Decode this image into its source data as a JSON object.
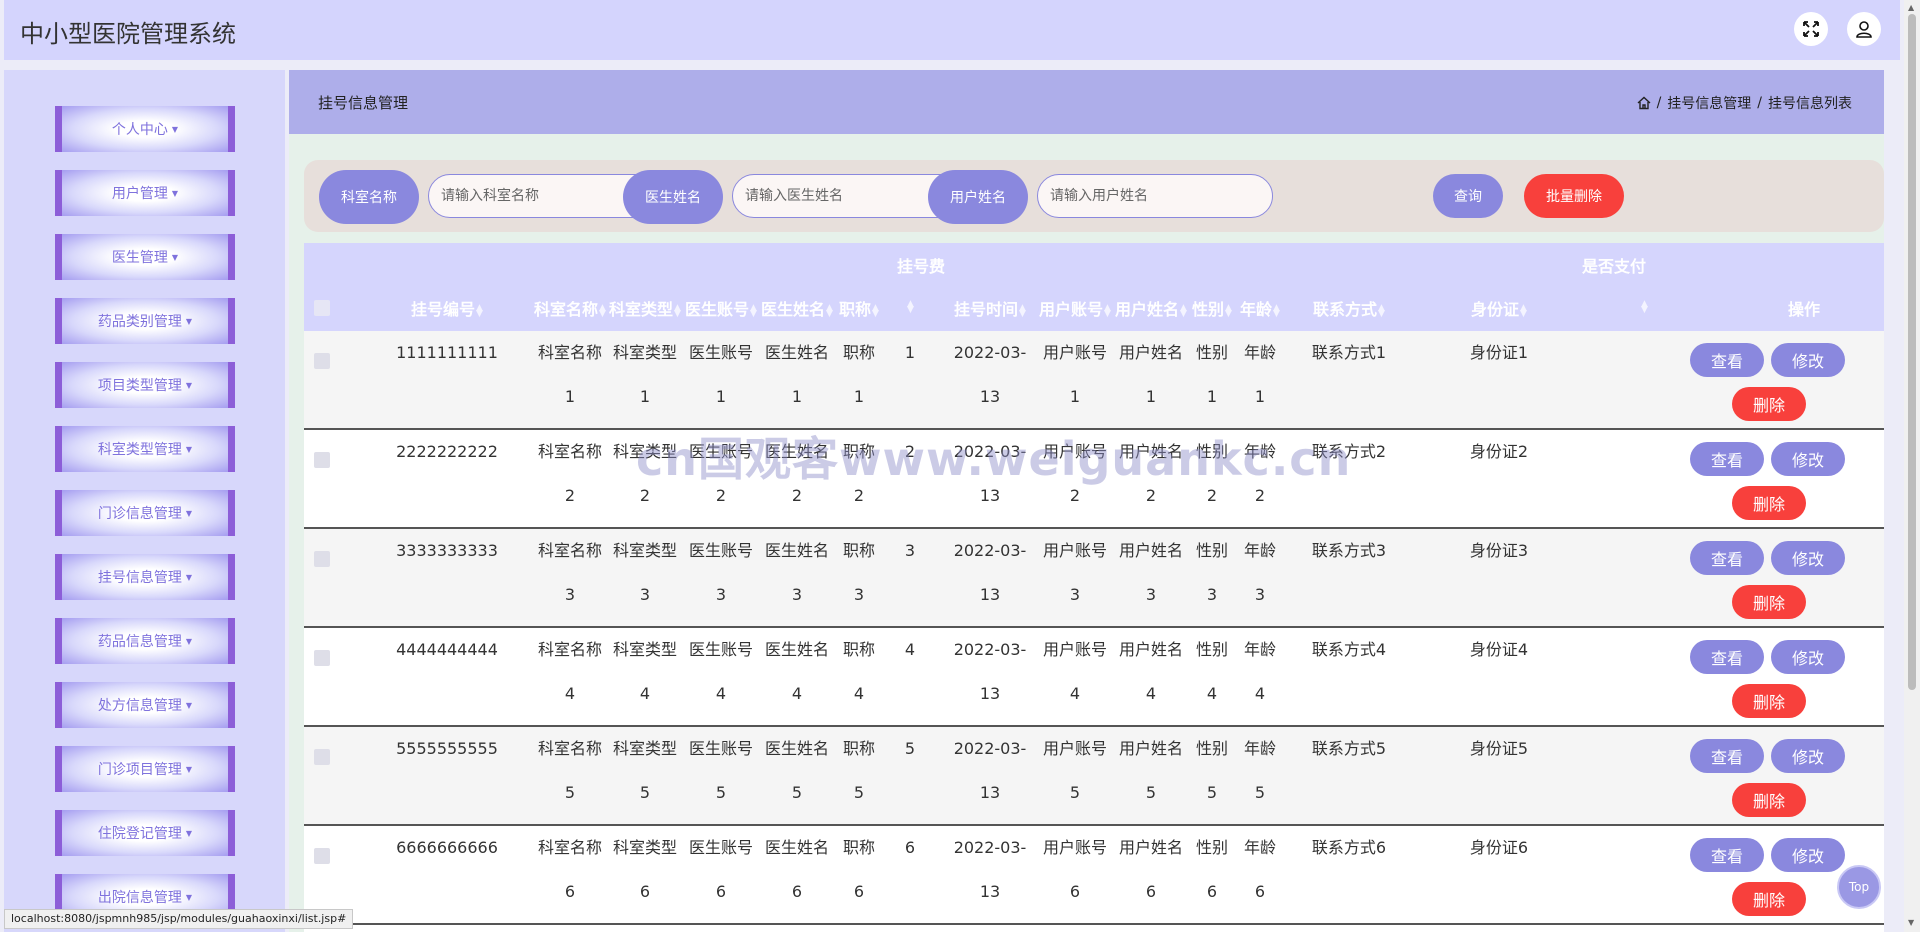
{
  "app": {
    "title": "中小型医院管理系统"
  },
  "header_icons": [
    "expand-icon",
    "user-icon"
  ],
  "sidebar": {
    "items": [
      {
        "label": "个人中心"
      },
      {
        "label": "用户管理"
      },
      {
        "label": "医生管理"
      },
      {
        "label": "药品类别管理"
      },
      {
        "label": "项目类型管理"
      },
      {
        "label": "科室类型管理"
      },
      {
        "label": "门诊信息管理"
      },
      {
        "label": "挂号信息管理"
      },
      {
        "label": "药品信息管理"
      },
      {
        "label": "处方信息管理"
      },
      {
        "label": "门诊项目管理"
      },
      {
        "label": "住院登记管理"
      },
      {
        "label": "出院信息管理"
      }
    ]
  },
  "page": {
    "title": "挂号信息管理",
    "breadcrumb": [
      "挂号信息管理",
      "挂号信息列表"
    ],
    "breadcrumb_sep": "/"
  },
  "search": {
    "dept_label": "科室名称",
    "dept_placeholder": "请输入科室名称",
    "doctor_label": "医生姓名",
    "doctor_placeholder": "请输入医生姓名",
    "user_label": "用户姓名",
    "user_placeholder": "请输入用户姓名",
    "query_label": "查询",
    "batch_delete_label": "批量删除"
  },
  "table": {
    "group_headers": {
      "fee": "挂号费",
      "paid": "是否支付"
    },
    "columns": {
      "reg_no": "挂号编号",
      "dept_name": "科室名称",
      "dept_type": "科室类型",
      "doctor_account": "医生账号",
      "doctor_name": "医生姓名",
      "title": "职称",
      "reg_time": "挂号时间",
      "user_account": "用户账号",
      "user_name": "用户姓名",
      "gender": "性别",
      "age": "年龄",
      "contact": "联系方式",
      "id_card": "身份证",
      "actions": "操作"
    },
    "rows": [
      {
        "reg_no": "1111111111",
        "dept_name": [
          "科室名称",
          "1"
        ],
        "dept_type": [
          "科室类型",
          "1"
        ],
        "doctor_account": [
          "医生账号",
          "1"
        ],
        "doctor_name": [
          "医生姓名",
          "1"
        ],
        "title": [
          "职称",
          "1"
        ],
        "fee": "1",
        "reg_time": [
          "2022-03-",
          "13"
        ],
        "user_account": [
          "用户账号",
          "1"
        ],
        "user_name": [
          "用户姓名",
          "1"
        ],
        "gender": [
          "性别",
          "1"
        ],
        "age": [
          "年龄",
          "1"
        ],
        "contact": "联系方式1",
        "id_card": "身份证1"
      },
      {
        "reg_no": "2222222222",
        "dept_name": [
          "科室名称",
          "2"
        ],
        "dept_type": [
          "科室类型",
          "2"
        ],
        "doctor_account": [
          "医生账号",
          "2"
        ],
        "doctor_name": [
          "医生姓名",
          "2"
        ],
        "title": [
          "职称",
          "2"
        ],
        "fee": "2",
        "reg_time": [
          "2022-03-",
          "13"
        ],
        "user_account": [
          "用户账号",
          "2"
        ],
        "user_name": [
          "用户姓名",
          "2"
        ],
        "gender": [
          "性别",
          "2"
        ],
        "age": [
          "年龄",
          "2"
        ],
        "contact": "联系方式2",
        "id_card": "身份证2"
      },
      {
        "reg_no": "3333333333",
        "dept_name": [
          "科室名称",
          "3"
        ],
        "dept_type": [
          "科室类型",
          "3"
        ],
        "doctor_account": [
          "医生账号",
          "3"
        ],
        "doctor_name": [
          "医生姓名",
          "3"
        ],
        "title": [
          "职称",
          "3"
        ],
        "fee": "3",
        "reg_time": [
          "2022-03-",
          "13"
        ],
        "user_account": [
          "用户账号",
          "3"
        ],
        "user_name": [
          "用户姓名",
          "3"
        ],
        "gender": [
          "性别",
          "3"
        ],
        "age": [
          "年龄",
          "3"
        ],
        "contact": "联系方式3",
        "id_card": "身份证3"
      },
      {
        "reg_no": "4444444444",
        "dept_name": [
          "科室名称",
          "4"
        ],
        "dept_type": [
          "科室类型",
          "4"
        ],
        "doctor_account": [
          "医生账号",
          "4"
        ],
        "doctor_name": [
          "医生姓名",
          "4"
        ],
        "title": [
          "职称",
          "4"
        ],
        "fee": "4",
        "reg_time": [
          "2022-03-",
          "13"
        ],
        "user_account": [
          "用户账号",
          "4"
        ],
        "user_name": [
          "用户姓名",
          "4"
        ],
        "gender": [
          "性别",
          "4"
        ],
        "age": [
          "年龄",
          "4"
        ],
        "contact": "联系方式4",
        "id_card": "身份证4"
      },
      {
        "reg_no": "5555555555",
        "dept_name": [
          "科室名称",
          "5"
        ],
        "dept_type": [
          "科室类型",
          "5"
        ],
        "doctor_account": [
          "医生账号",
          "5"
        ],
        "doctor_name": [
          "医生姓名",
          "5"
        ],
        "title": [
          "职称",
          "5"
        ],
        "fee": "5",
        "reg_time": [
          "2022-03-",
          "13"
        ],
        "user_account": [
          "用户账号",
          "5"
        ],
        "user_name": [
          "用户姓名",
          "5"
        ],
        "gender": [
          "性别",
          "5"
        ],
        "age": [
          "年龄",
          "5"
        ],
        "contact": "联系方式5",
        "id_card": "身份证5"
      },
      {
        "reg_no": "6666666666",
        "dept_name": [
          "科室名称",
          "6"
        ],
        "dept_type": [
          "科室类型",
          "6"
        ],
        "doctor_account": [
          "医生账号",
          "6"
        ],
        "doctor_name": [
          "医生姓名",
          "6"
        ],
        "title": [
          "职称",
          "6"
        ],
        "fee": "6",
        "reg_time": [
          "2022-03-",
          "13"
        ],
        "user_account": [
          "用户账号",
          "6"
        ],
        "user_name": [
          "用户姓名",
          "6"
        ],
        "gender": [
          "性别",
          "6"
        ],
        "age": [
          "年龄",
          "6"
        ],
        "contact": "联系方式6",
        "id_card": "身份证6"
      }
    ],
    "actions": {
      "view": "查看",
      "edit": "修改",
      "delete": "删除"
    }
  },
  "top_button_label": "Top",
  "status_url": "localhost:8080/jspmnh985/jsp/modules/guahaoxinxi/list.jsp#",
  "watermark": "cn国观客www.weiguankc.cn",
  "colors": {
    "accent": "#8a88de",
    "danger": "#f8403c",
    "header_bg": "#d4d4fd",
    "sidebar_bg": "#d7d7fb",
    "breadcrumb_bg": "#aeaeea",
    "menu_border": "#8c5ed8"
  }
}
